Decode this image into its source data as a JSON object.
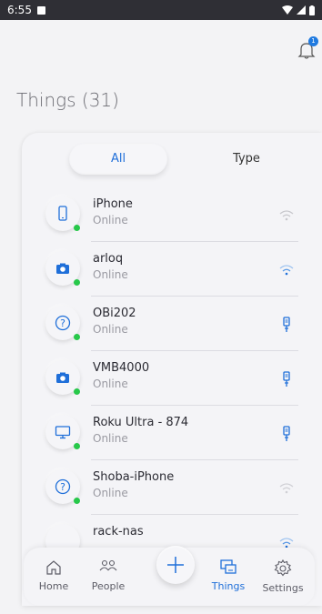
{
  "status_bar": {
    "time": "6:55"
  },
  "header": {
    "title": "Things (31)",
    "notification_count": "1"
  },
  "filter_tabs": [
    {
      "label": "All",
      "selected": true
    },
    {
      "label": "Type",
      "selected": false
    }
  ],
  "devices": [
    {
      "name": "iPhone",
      "status": "Online",
      "icon": "phone-icon",
      "connection": "wifi-icon-grey"
    },
    {
      "name": "arloq",
      "status": "Online",
      "icon": "camera-icon",
      "connection": "wifi-icon-blue"
    },
    {
      "name": "OBi202",
      "status": "Online",
      "icon": "question-icon",
      "connection": "ethernet-icon"
    },
    {
      "name": "VMB4000",
      "status": "Online",
      "icon": "camera-icon",
      "connection": "ethernet-icon"
    },
    {
      "name": "Roku Ultra - 874",
      "status": "Online",
      "icon": "monitor-icon",
      "connection": "ethernet-icon"
    },
    {
      "name": "Shoba-iPhone",
      "status": "Online",
      "icon": "question-icon",
      "connection": "wifi-icon-grey"
    },
    {
      "name": "rack-nas",
      "status": "",
      "icon": "",
      "connection": "wifi-icon-blue"
    }
  ],
  "bottom_nav": [
    {
      "label": "Home",
      "icon": "home-icon"
    },
    {
      "label": "People",
      "icon": "people-icon"
    },
    {
      "label": "",
      "icon": "add-icon"
    },
    {
      "label": "Things",
      "icon": "things-icon",
      "active": true
    },
    {
      "label": "Settings",
      "icon": "gear-icon"
    }
  ],
  "colors": {
    "accent": "#1f6fd9",
    "online_dot": "#27c84a",
    "background": "#f3f3f5"
  }
}
